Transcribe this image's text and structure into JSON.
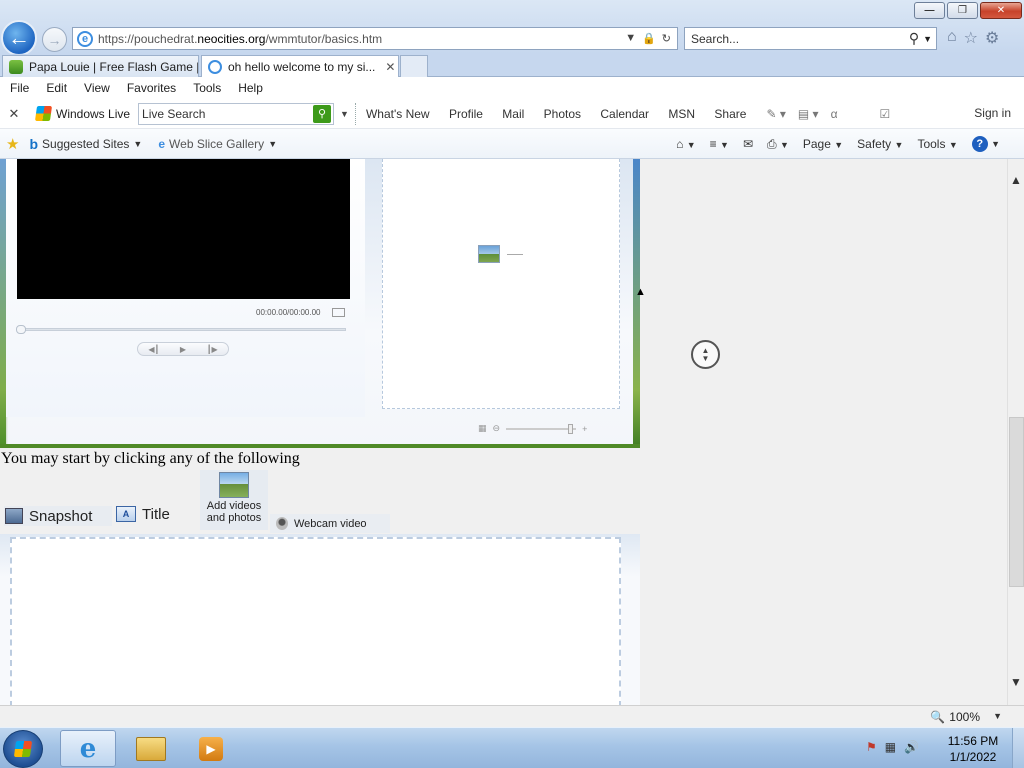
{
  "browser": {
    "url_prefix": "https://pouchedrat.",
    "url_domain": "neocities.org",
    "url_path": "/wmmtutor/basics.htm",
    "search_placeholder": "Search...",
    "tabs": [
      {
        "label": "Papa Louie | Free Flash Game |...",
        "active": false
      },
      {
        "label": "oh hello welcome to my si...",
        "active": true
      }
    ],
    "menu": [
      "File",
      "Edit",
      "View",
      "Favorites",
      "Tools",
      "Help"
    ]
  },
  "live_toolbar": {
    "brand": "Windows Live",
    "search_placeholder": "Live Search",
    "links": [
      "What's New",
      "Profile",
      "Mail",
      "Photos",
      "Calendar",
      "MSN",
      "Share"
    ],
    "sign_in": "Sign in"
  },
  "favorites_bar": {
    "suggested_sites": "Suggested Sites",
    "web_slice_gallery": "Web Slice Gallery",
    "commands": [
      "Page",
      "Safety",
      "Tools"
    ]
  },
  "page": {
    "player": {
      "timecode": "00:00.00/00:00.00"
    },
    "intro_text": "You may start by clicking any of the following",
    "tasks": {
      "snapshot": "Snapshot",
      "title": "Title",
      "add_videos_line1": "Add videos",
      "add_videos_line2": "and photos",
      "webcam": "Webcam video"
    }
  },
  "status": {
    "zoom": "100%"
  },
  "taskbar": {
    "time": "11:56 PM",
    "date": "1/1/2022"
  }
}
